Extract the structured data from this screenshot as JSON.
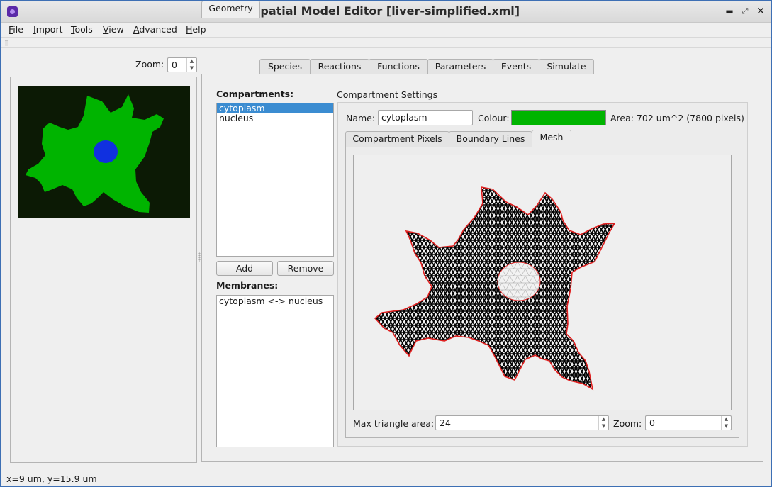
{
  "window": {
    "title": "Spatial Model Editor [liver-simplified.xml]",
    "controls": [
      "minimize-icon",
      "restore-icon",
      "close-icon"
    ]
  },
  "menubar": {
    "items": [
      "File",
      "Import",
      "Tools",
      "View",
      "Advanced",
      "Help"
    ]
  },
  "left": {
    "zoom_label": "Zoom:",
    "zoom_value": "0",
    "image_colors": {
      "background": "#0c1a05",
      "cytoplasm": "#00b400",
      "nucleus": "#1030e0"
    }
  },
  "tabs": [
    "Geometry",
    "Species",
    "Reactions",
    "Functions",
    "Parameters",
    "Events",
    "Simulate"
  ],
  "active_tab": "Geometry",
  "geometry": {
    "compartments_label": "Compartments:",
    "compartments": [
      "cytoplasm",
      "nucleus"
    ],
    "selected_compartment": "cytoplasm",
    "add_label": "Add",
    "remove_label": "Remove",
    "membranes_label": "Membranes:",
    "membranes": [
      "cytoplasm <-> nucleus"
    ],
    "settings_title": "Compartment Settings",
    "name_label": "Name:",
    "name_value": "cytoplasm",
    "colour_label": "Colour:",
    "colour_value": "#00b400",
    "area_text": "Area: 702 um^2 (7800 pixels)",
    "subtabs": [
      "Compartment Pixels",
      "Boundary Lines",
      "Mesh"
    ],
    "active_subtab": "Mesh",
    "max_triangle_label": "Max triangle area:",
    "max_triangle_value": "24",
    "mesh_zoom_label": "Zoom:",
    "mesh_zoom_value": "0"
  },
  "status": {
    "text": "x=9 um, y=15.9 um"
  }
}
